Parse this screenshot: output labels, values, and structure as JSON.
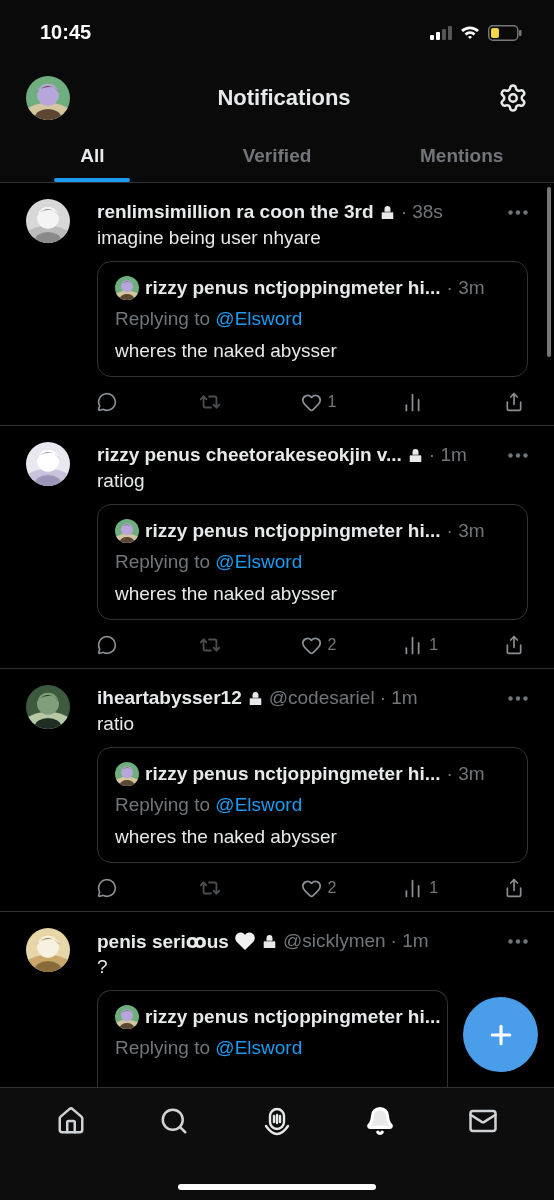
{
  "status_bar": {
    "time": "10:45"
  },
  "header": {
    "title": "Notifications"
  },
  "tabs": [
    {
      "label": "All",
      "selected": true
    },
    {
      "label": "Verified",
      "selected": false
    },
    {
      "label": "Mentions",
      "selected": false
    }
  ],
  "posts": [
    {
      "name": "renlimsimillion ra coon the 3rd",
      "locked": true,
      "hearted": false,
      "time": "· 38s",
      "text": "imagine being user nhyare",
      "quote": {
        "name": "rizzy penus nctjoppingmeter hi...",
        "time": "· 3m",
        "reply_prefix": "Replying to",
        "reply_handle": "@Elsword",
        "text": "wheres the naked abysser"
      },
      "likes": "1"
    },
    {
      "name": "rizzy penus cheetorakeseokjin v...",
      "locked": true,
      "hearted": false,
      "time": "· 1m",
      "text": "ratiog",
      "quote": {
        "name": "rizzy penus nctjoppingmeter hi...",
        "time": "· 3m",
        "reply_prefix": "Replying to",
        "reply_handle": "@Elsword",
        "text": "wheres the naked abysser"
      },
      "likes": "2",
      "views": "1"
    },
    {
      "name": "iheartabysser12",
      "locked": true,
      "hearted": false,
      "handle": "@codesariel",
      "time": "· 1m",
      "text": "ratio",
      "quote": {
        "name": "rizzy penus nctjoppingmeter hi...",
        "time": "· 3m",
        "reply_prefix": "Replying to",
        "reply_handle": "@Elsword",
        "text": "wheres the naked abysser"
      },
      "likes": "2",
      "views": "1"
    },
    {
      "name": "penis seriꝏus",
      "locked": true,
      "hearted": true,
      "handle": "@sicklymen",
      "time": "· 1m",
      "text": "?",
      "quote": {
        "name": "rizzy penus nctjoppingmeter hi...",
        "reply_prefix": "Replying to",
        "reply_handle": "@Elsword"
      }
    }
  ],
  "bottom_nav": [
    {
      "kind": "home",
      "selected": false
    },
    {
      "kind": "search",
      "selected": false
    },
    {
      "kind": "spaces",
      "selected": false
    },
    {
      "kind": "notifications",
      "selected": true
    },
    {
      "kind": "messages",
      "selected": false
    }
  ]
}
